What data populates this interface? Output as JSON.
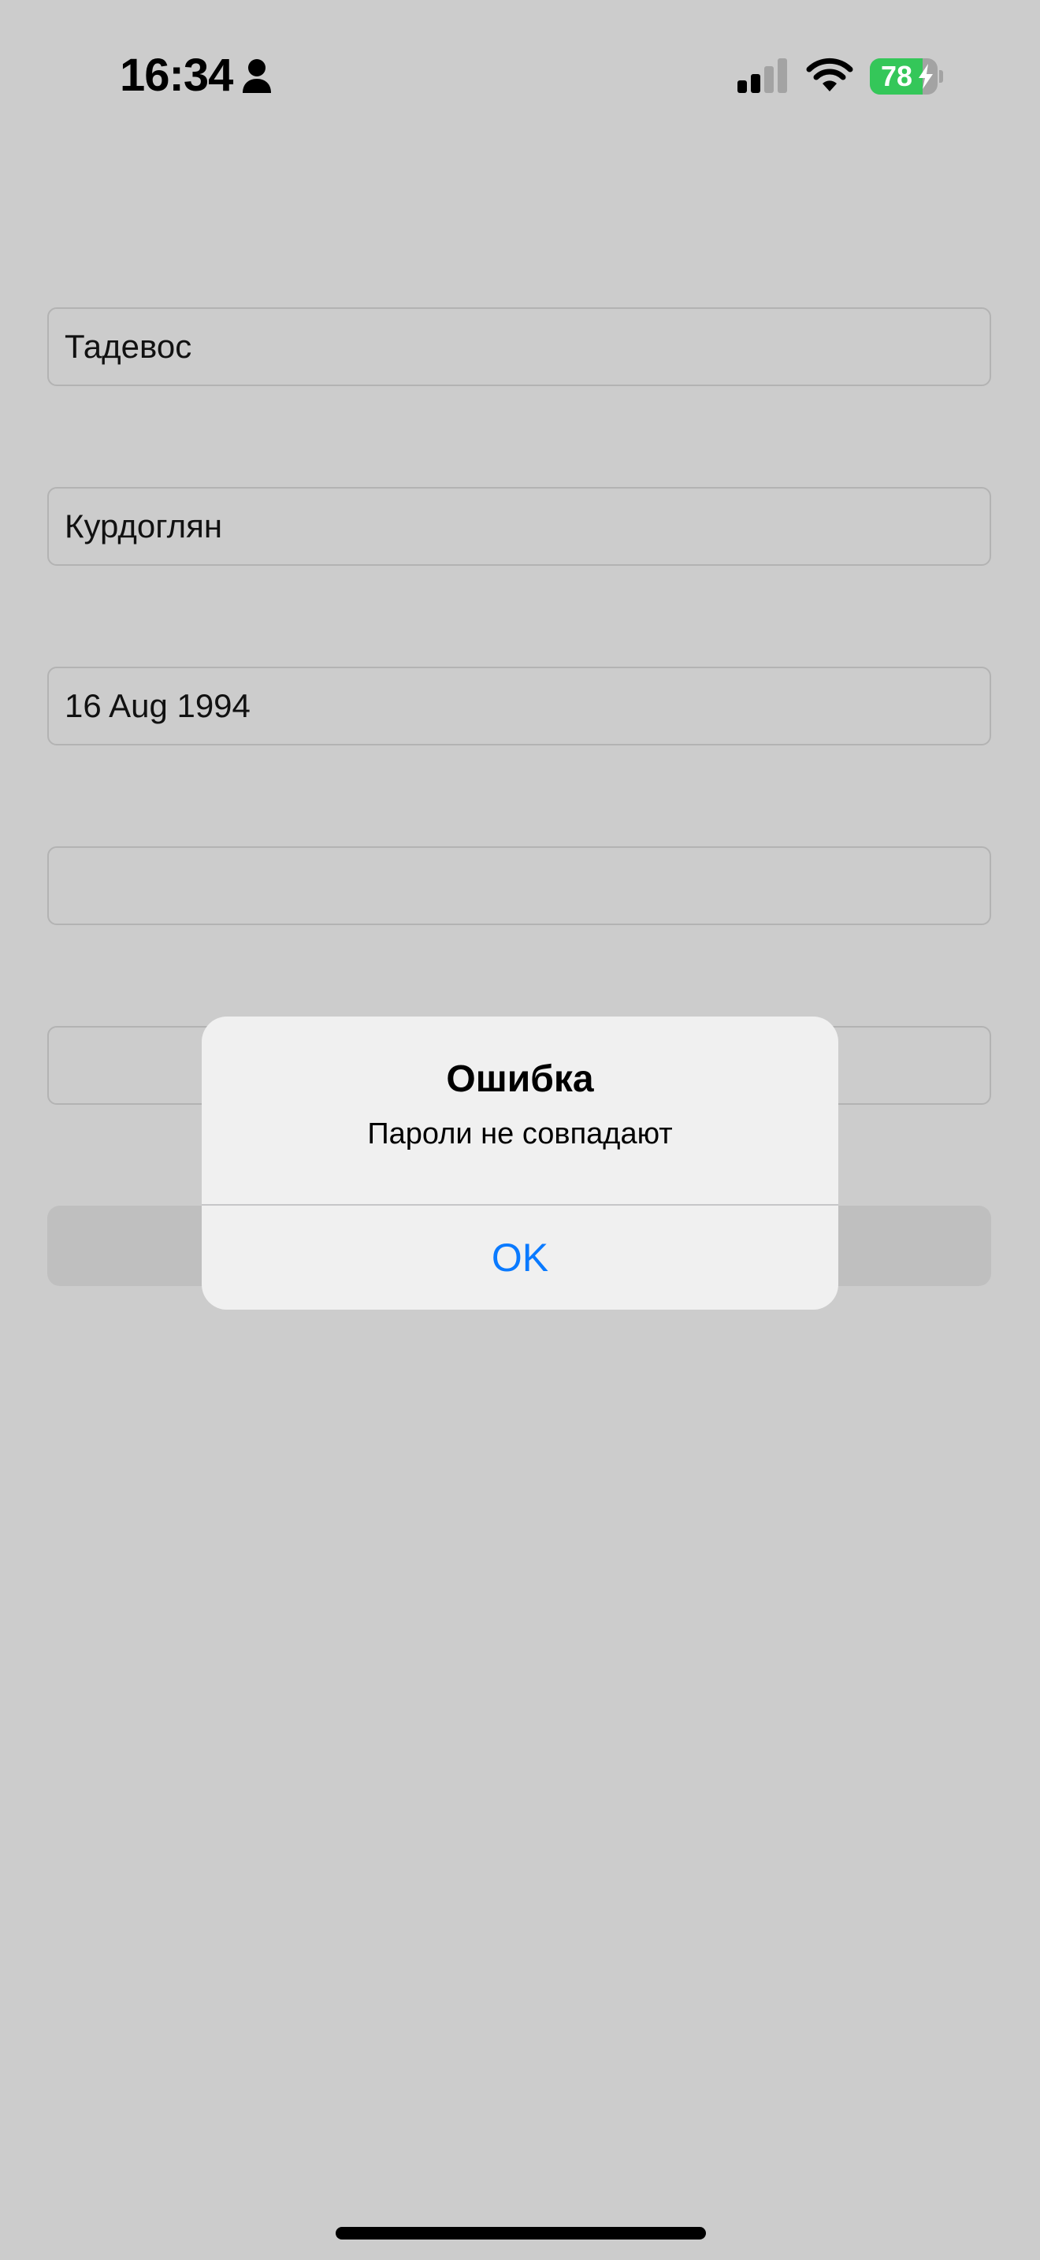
{
  "status_bar": {
    "time": "16:34",
    "battery_percent": 78,
    "battery_text": "78",
    "icons": [
      "person-icon",
      "cellular-signal-icon",
      "wifi-icon",
      "battery-charging-icon"
    ],
    "battery_color": "#34c759"
  },
  "form": {
    "first_name": "Тадевос",
    "last_name": "Курдоглян",
    "birth_date": "16 Aug 1994",
    "password": "",
    "password_confirm": ""
  },
  "alert": {
    "title": "Ошибка",
    "message": "Пароли не совпадают",
    "ok_label": "OK",
    "ok_color": "#0a7aff"
  }
}
